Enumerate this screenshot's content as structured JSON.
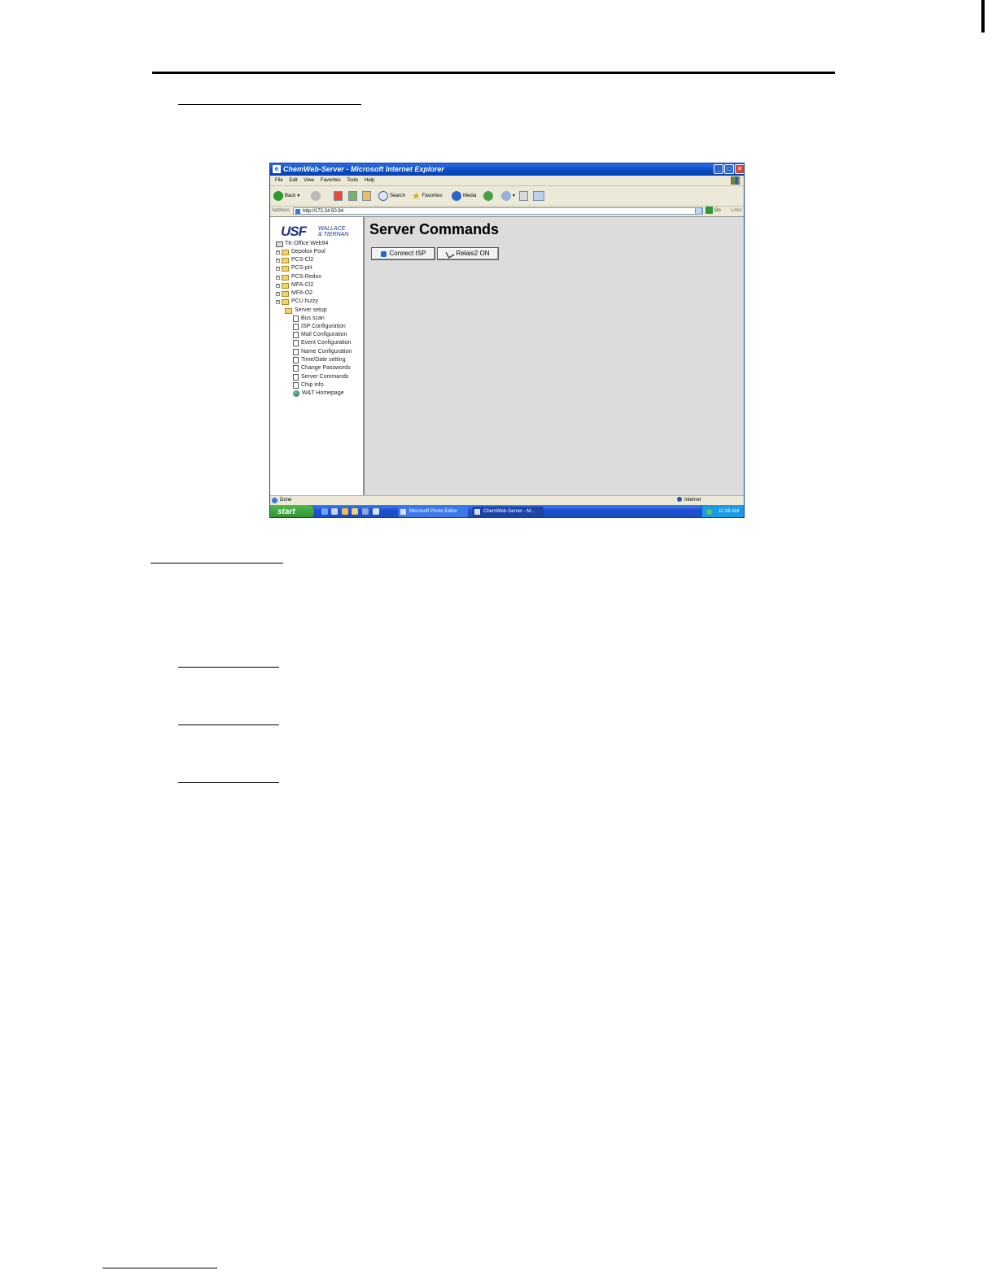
{
  "window": {
    "title": "ChemWeb-Server - Microsoft Internet Explorer",
    "min": "_",
    "max": "□",
    "close": "×"
  },
  "menu": [
    "File",
    "Edit",
    "View",
    "Favorites",
    "Tools",
    "Help"
  ],
  "toolbar": {
    "back": "Back",
    "search": "Search",
    "favorites": "Favorites",
    "media": "Media"
  },
  "address": {
    "label": "Address",
    "url": "http://172.24.50.94",
    "go": "Go",
    "links": "Links"
  },
  "logo": {
    "main": "USF",
    "line1": "WALLACE",
    "line2": "& TIERNAN"
  },
  "tree": {
    "root": "TK-Office Web94",
    "folders": [
      "Depolox Pool",
      "PCS-Cl2",
      "PCS-pH",
      "PCS-Redox",
      "MFA-Cl2",
      "MFA-O2",
      "PCU fuzzy"
    ],
    "open_folder": "Server setup",
    "pages": [
      "Bus scan",
      "ISP Configuration",
      "Mail Configuration",
      "Event Configuration",
      "Name Configuration",
      "Time/Date setting",
      "Change Passwords",
      "Server Commands",
      "Chip info"
    ],
    "home": "W&T Homepage"
  },
  "main": {
    "heading": "Server Commands",
    "buttons": [
      "Connect ISP",
      "Relais2 ON"
    ]
  },
  "status": {
    "text": "Done",
    "zone": "Internet"
  },
  "taskbar": {
    "start": "start",
    "tasks": [
      "Microsoft Photo Editor",
      "ChemWeb-Server - M..."
    ],
    "clock": "11:26 AM"
  }
}
